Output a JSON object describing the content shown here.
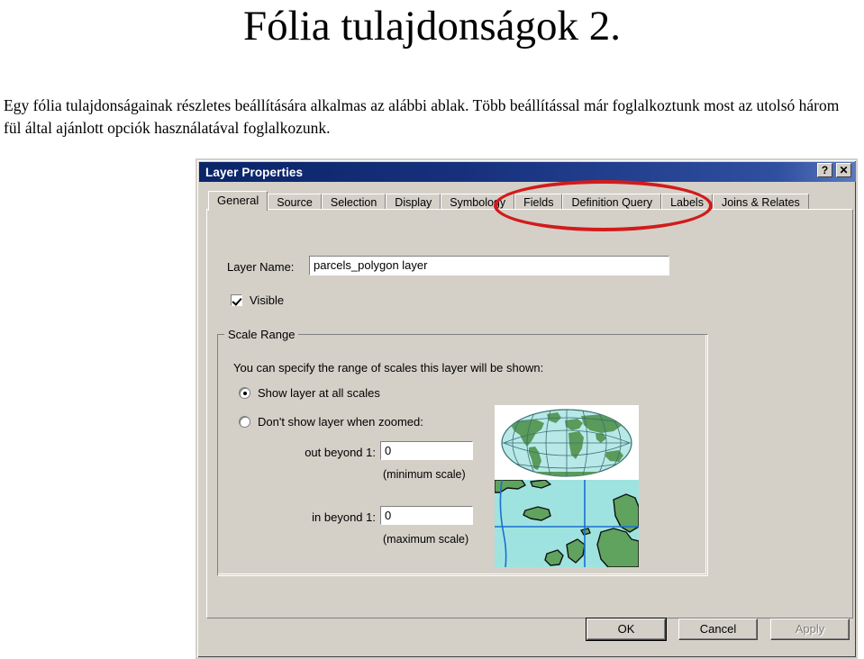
{
  "slide": {
    "title": "Fólia tulajdonságok 2.",
    "body": "Egy fólia tulajdonságainak részletes beállítására alkalmas az alábbi ablak. Több beállítással már foglalkoztunk most az utolsó három fül által ajánlott opciók használatával foglalkozunk."
  },
  "dialog": {
    "titlebar": {
      "title": "Layer Properties",
      "help_label": "?",
      "close_label": "✕"
    },
    "tabs": [
      {
        "label": "General",
        "selected": true
      },
      {
        "label": "Source",
        "selected": false
      },
      {
        "label": "Selection",
        "selected": false
      },
      {
        "label": "Display",
        "selected": false
      },
      {
        "label": "Symbology",
        "selected": false
      },
      {
        "label": "Fields",
        "selected": false
      },
      {
        "label": "Definition Query",
        "selected": false
      },
      {
        "label": "Labels",
        "selected": false
      },
      {
        "label": "Joins & Relates",
        "selected": false
      }
    ],
    "general": {
      "layer_name_label": "Layer Name:",
      "layer_name_value": "parcels_polygon layer",
      "visible_label": "Visible",
      "visible_checked": true,
      "scale_range": {
        "legend": "Scale Range",
        "description": "You can specify the range of scales this layer will be shown:",
        "radio_all_label": "Show layer at all scales",
        "radio_all_selected": true,
        "radio_zoom_label": "Don't show layer when zoomed:",
        "radio_zoom_selected": false,
        "out_beyond_label": "out beyond  1:",
        "out_beyond_value": "0",
        "minimum_scale_note": "(minimum scale)",
        "in_beyond_label": "in beyond  1:",
        "in_beyond_value": "0",
        "maximum_scale_note": "(maximum scale)"
      }
    },
    "buttons": {
      "ok": "OK",
      "cancel": "Cancel",
      "apply": "Apply",
      "apply_disabled": true
    }
  },
  "annotation": {
    "shape": "red-ellipse",
    "highlights": [
      "Fields",
      "Definition Query",
      "Labels"
    ],
    "color": "#d21b1b"
  },
  "colors": {
    "dialog_face": "#d4d0c8",
    "titlebar_start": "#0b2569",
    "titlebar_end": "#5a79c0",
    "map_ocean": "#b8e8e8",
    "map_land": "#5a9a5a",
    "map_region_ocean": "#9fe3e0",
    "map_region_land": "#5fa35f",
    "annotation_red": "#d21b1b"
  }
}
